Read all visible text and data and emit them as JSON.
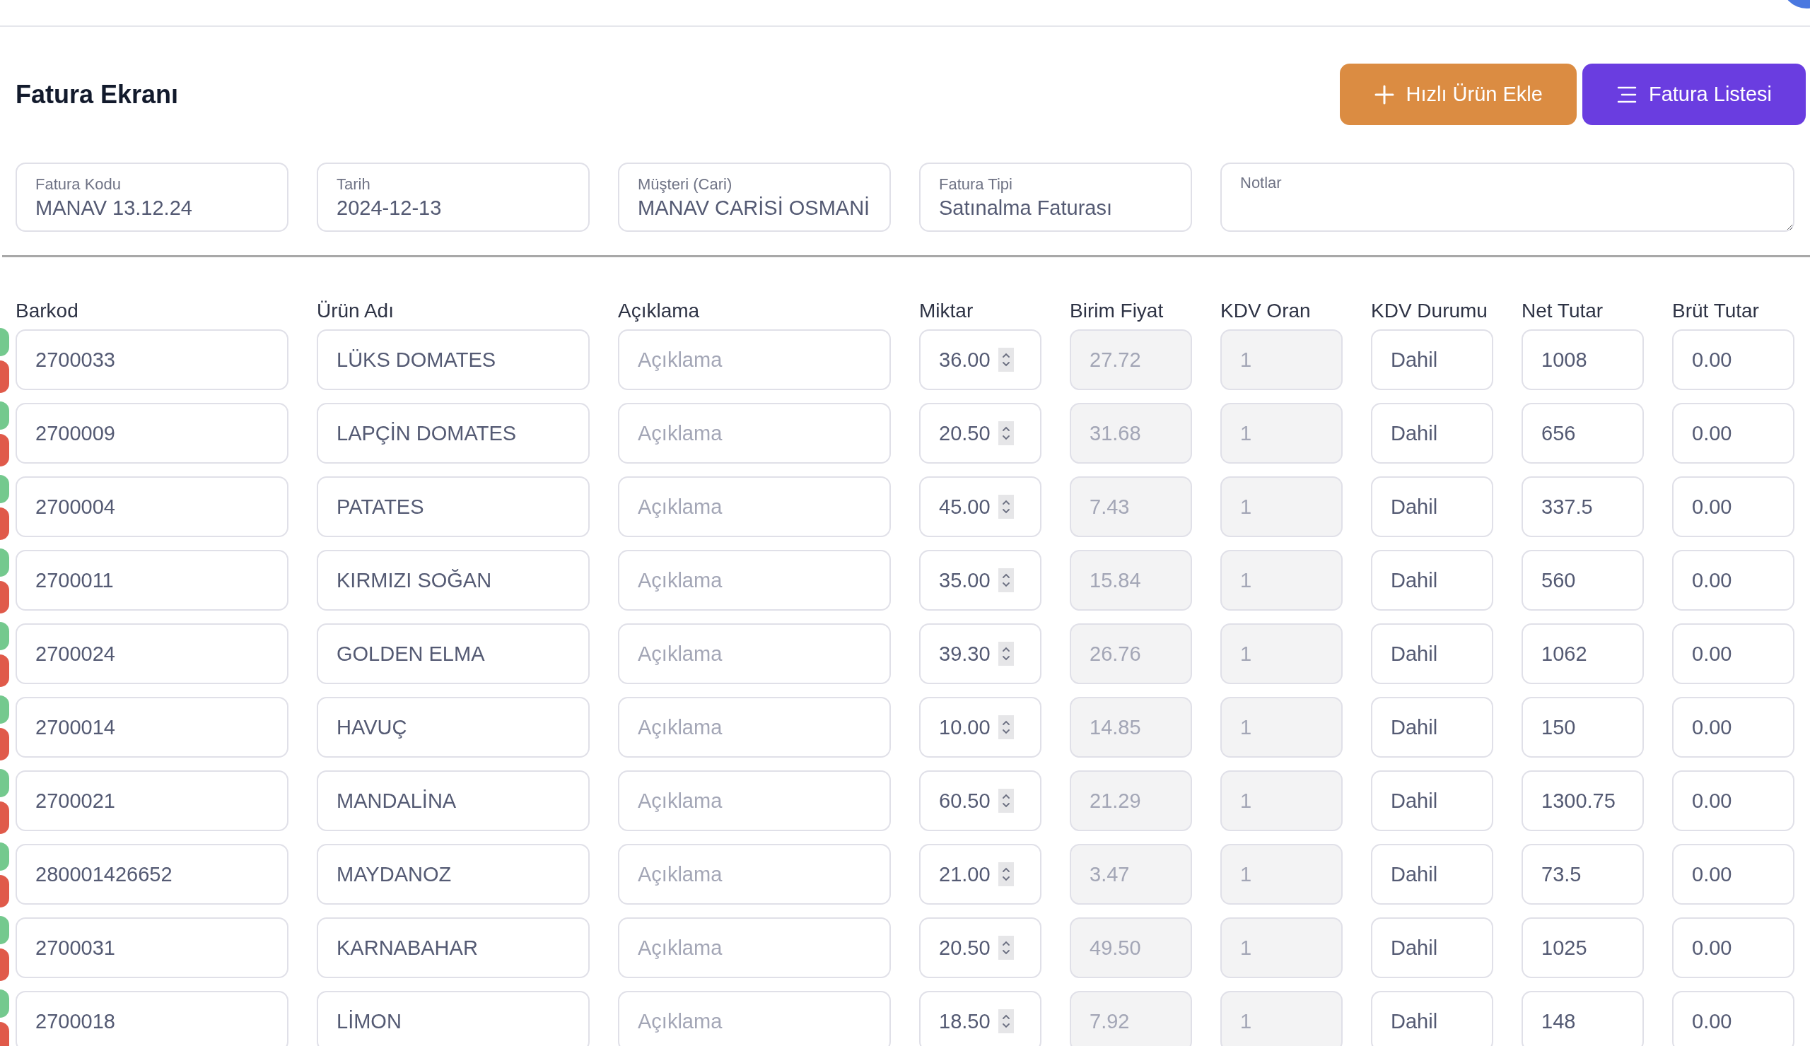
{
  "title": "Fatura Ekranı",
  "buttons": [
    {
      "label": "Hızlı Ürün Ekle",
      "kind": "add"
    },
    {
      "label": "Fatura Listesi",
      "kind": "list"
    }
  ],
  "fields": [
    {
      "label": "Fatura Kodu",
      "value": "MANAV 13.12.24"
    },
    {
      "label": "Tarih",
      "value": "2024-12-13"
    },
    {
      "label": "Müşteri (Cari)",
      "value": "MANAV CARİSİ OSMANİ"
    },
    {
      "label": "Fatura Tipi",
      "value": "Satınalma Faturası"
    }
  ],
  "notes": {
    "placeholder": "Notlar"
  },
  "columns": [
    {
      "label": "Barkod",
      "disabled": false
    },
    {
      "label": "Ürün Adı",
      "disabled": false
    },
    {
      "label": "Açıklama",
      "disabled": false
    },
    {
      "label": "Miktar",
      "disabled": false,
      "kind": "spinner"
    },
    {
      "label": "Birim Fiyat",
      "disabled": true
    },
    {
      "label": "KDV Oran",
      "disabled": true
    },
    {
      "label": "KDV Durumu",
      "disabled": false
    },
    {
      "label": "Net Tutar",
      "disabled": false
    },
    {
      "label": "Brüt Tutar",
      "disabled": false
    }
  ],
  "rows": [
    {
      "cells": [
        {
          "value": "2700033"
        },
        {
          "value": "LÜKS DOMATES"
        },
        {
          "placeholder": "Açıklama"
        },
        {
          "value": "36.00"
        },
        {
          "value": "27.72"
        },
        {
          "value": "1"
        },
        {
          "value": "Dahil"
        },
        {
          "value": "1008"
        },
        {
          "value": "0.00"
        }
      ]
    },
    {
      "cells": [
        {
          "value": "2700009"
        },
        {
          "value": "LAPÇİN DOMATES"
        },
        {
          "placeholder": "Açıklama"
        },
        {
          "value": "20.50"
        },
        {
          "value": "31.68"
        },
        {
          "value": "1"
        },
        {
          "value": "Dahil"
        },
        {
          "value": "656"
        },
        {
          "value": "0.00"
        }
      ]
    },
    {
      "cells": [
        {
          "value": "2700004"
        },
        {
          "value": "PATATES"
        },
        {
          "placeholder": "Açıklama"
        },
        {
          "value": "45.00"
        },
        {
          "value": "7.43"
        },
        {
          "value": "1"
        },
        {
          "value": "Dahil"
        },
        {
          "value": "337.5"
        },
        {
          "value": "0.00"
        }
      ]
    },
    {
      "cells": [
        {
          "value": "2700011"
        },
        {
          "value": "KIRMIZI SOĞAN"
        },
        {
          "placeholder": "Açıklama"
        },
        {
          "value": "35.00"
        },
        {
          "value": "15.84"
        },
        {
          "value": "1"
        },
        {
          "value": "Dahil"
        },
        {
          "value": "560"
        },
        {
          "value": "0.00"
        }
      ]
    },
    {
      "cells": [
        {
          "value": "2700024"
        },
        {
          "value": "GOLDEN ELMA"
        },
        {
          "placeholder": "Açıklama"
        },
        {
          "value": "39.30"
        },
        {
          "value": "26.76"
        },
        {
          "value": "1"
        },
        {
          "value": "Dahil"
        },
        {
          "value": "1062"
        },
        {
          "value": "0.00"
        }
      ]
    },
    {
      "cells": [
        {
          "value": "2700014"
        },
        {
          "value": "HAVUÇ"
        },
        {
          "placeholder": "Açıklama"
        },
        {
          "value": "10.00"
        },
        {
          "value": "14.85"
        },
        {
          "value": "1"
        },
        {
          "value": "Dahil"
        },
        {
          "value": "150"
        },
        {
          "value": "0.00"
        }
      ]
    },
    {
      "cells": [
        {
          "value": "2700021"
        },
        {
          "value": "MANDALİNA"
        },
        {
          "placeholder": "Açıklama"
        },
        {
          "value": "60.50"
        },
        {
          "value": "21.29"
        },
        {
          "value": "1"
        },
        {
          "value": "Dahil"
        },
        {
          "value": "1300.75"
        },
        {
          "value": "0.00"
        }
      ]
    },
    {
      "cells": [
        {
          "value": "280001426652"
        },
        {
          "value": "MAYDANOZ"
        },
        {
          "placeholder": "Açıklama"
        },
        {
          "value": "21.00"
        },
        {
          "value": "3.47"
        },
        {
          "value": "1"
        },
        {
          "value": "Dahil"
        },
        {
          "value": "73.5"
        },
        {
          "value": "0.00"
        }
      ]
    },
    {
      "cells": [
        {
          "value": "2700031"
        },
        {
          "value": "KARNABAHAR"
        },
        {
          "placeholder": "Açıklama"
        },
        {
          "value": "20.50"
        },
        {
          "value": "49.50"
        },
        {
          "value": "1"
        },
        {
          "value": "Dahil"
        },
        {
          "value": "1025"
        },
        {
          "value": "0.00"
        }
      ]
    },
    {
      "cells": [
        {
          "value": "2700018"
        },
        {
          "value": "LİMON"
        },
        {
          "placeholder": "Açıklama"
        },
        {
          "value": "18.50"
        },
        {
          "value": "7.92"
        },
        {
          "value": "1"
        },
        {
          "value": "Dahil"
        },
        {
          "value": "148"
        },
        {
          "value": "0.00"
        }
      ]
    }
  ]
}
